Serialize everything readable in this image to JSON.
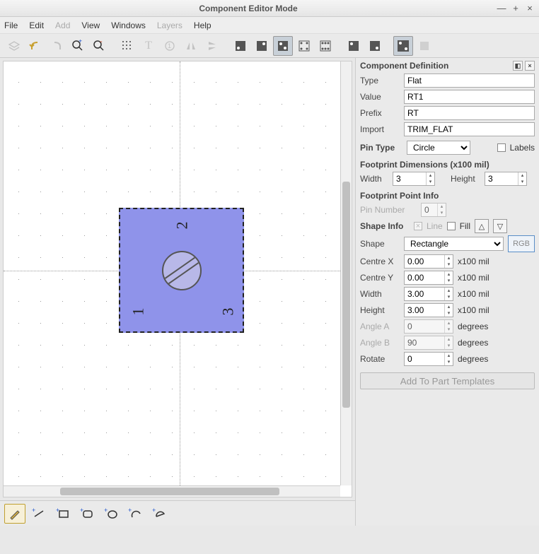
{
  "window": {
    "title": "Component Editor Mode"
  },
  "menu": {
    "file": "File",
    "edit": "Edit",
    "add": "Add",
    "view": "View",
    "windows": "Windows",
    "layers": "Layers",
    "help": "Help"
  },
  "panel": {
    "title": "Component Definition",
    "type_label": "Type",
    "type_value": "Flat",
    "value_label": "Value",
    "value_value": "RT1",
    "prefix_label": "Prefix",
    "prefix_value": "RT",
    "import_label": "Import",
    "import_value": "TRIM_FLAT",
    "pintype_label": "Pin Type",
    "pintype_value": "Circle",
    "labels_cb": "Labels",
    "dims_title": "Footprint Dimensions (x100 mil)",
    "width_label": "Width",
    "width_value": "3",
    "height_label": "Height",
    "height_value": "3",
    "point_title": "Footprint Point Info",
    "pinnum_label": "Pin Number",
    "pinnum_value": "0",
    "shapeinfo_label": "Shape Info",
    "line_label": "Line",
    "fill_label": "Fill",
    "shape_label": "Shape",
    "shape_value": "Rectangle",
    "rgb": "RGB",
    "cx_label": "Centre X",
    "cx_value": "0.00",
    "cx_unit": "x100 mil",
    "cy_label": "Centre Y",
    "cy_value": "0.00",
    "cy_unit": "x100 mil",
    "sw_label": "Width",
    "sw_value": "3.00",
    "sw_unit": "x100 mil",
    "sh_label": "Height",
    "sh_value": "3.00",
    "sh_unit": "x100 mil",
    "aa_label": "Angle A",
    "aa_value": "0",
    "aa_unit": "degrees",
    "ab_label": "Angle B",
    "ab_value": "90",
    "ab_unit": "degrees",
    "rot_label": "Rotate",
    "rot_value": "0",
    "rot_unit": "degrees",
    "add_btn": "Add To Part Templates"
  },
  "canvas": {
    "pins": {
      "p1": "1",
      "p2": "2",
      "p3": "3"
    }
  }
}
